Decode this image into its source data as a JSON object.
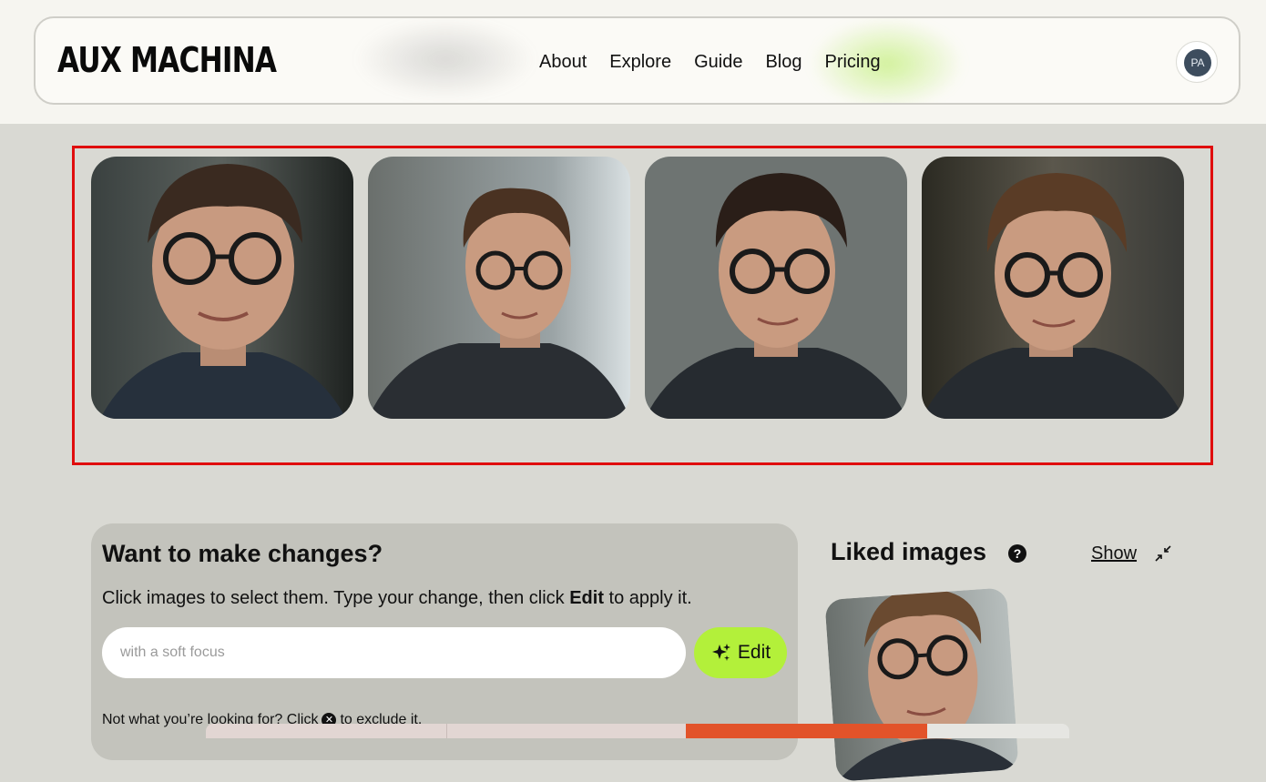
{
  "header": {
    "logo": "AUX MACHINA",
    "nav": [
      {
        "label": "About"
      },
      {
        "label": "Explore"
      },
      {
        "label": "Guide"
      },
      {
        "label": "Blog"
      },
      {
        "label": "Pricing"
      }
    ],
    "avatar_initials": "PA"
  },
  "gallery": {
    "images": [
      {
        "icon": "portrait-man-glasses"
      },
      {
        "icon": "portrait-man-glasses"
      },
      {
        "icon": "portrait-man-glasses"
      },
      {
        "icon": "portrait-man-glasses"
      }
    ]
  },
  "edit": {
    "title": "Want to make changes?",
    "instruction_pre": "Click images to select them. Type your change, then click ",
    "instruction_bold": "Edit",
    "instruction_post": " to apply it.",
    "input_value": "",
    "input_placeholder": "with a soft focus",
    "button_label": "Edit",
    "exclude_pre": "Not what you’re looking for? Click",
    "exclude_post": "to exclude it."
  },
  "liked": {
    "title": "Liked images",
    "show_label": "Show"
  },
  "colors": {
    "accent_green": "#b3f03a",
    "selection_border": "#e00d0d",
    "background": "#d9d9d3",
    "strip": [
      "#e2d6d3",
      "#e2d6d3",
      "#e2532a",
      "#e6e6e2"
    ]
  }
}
